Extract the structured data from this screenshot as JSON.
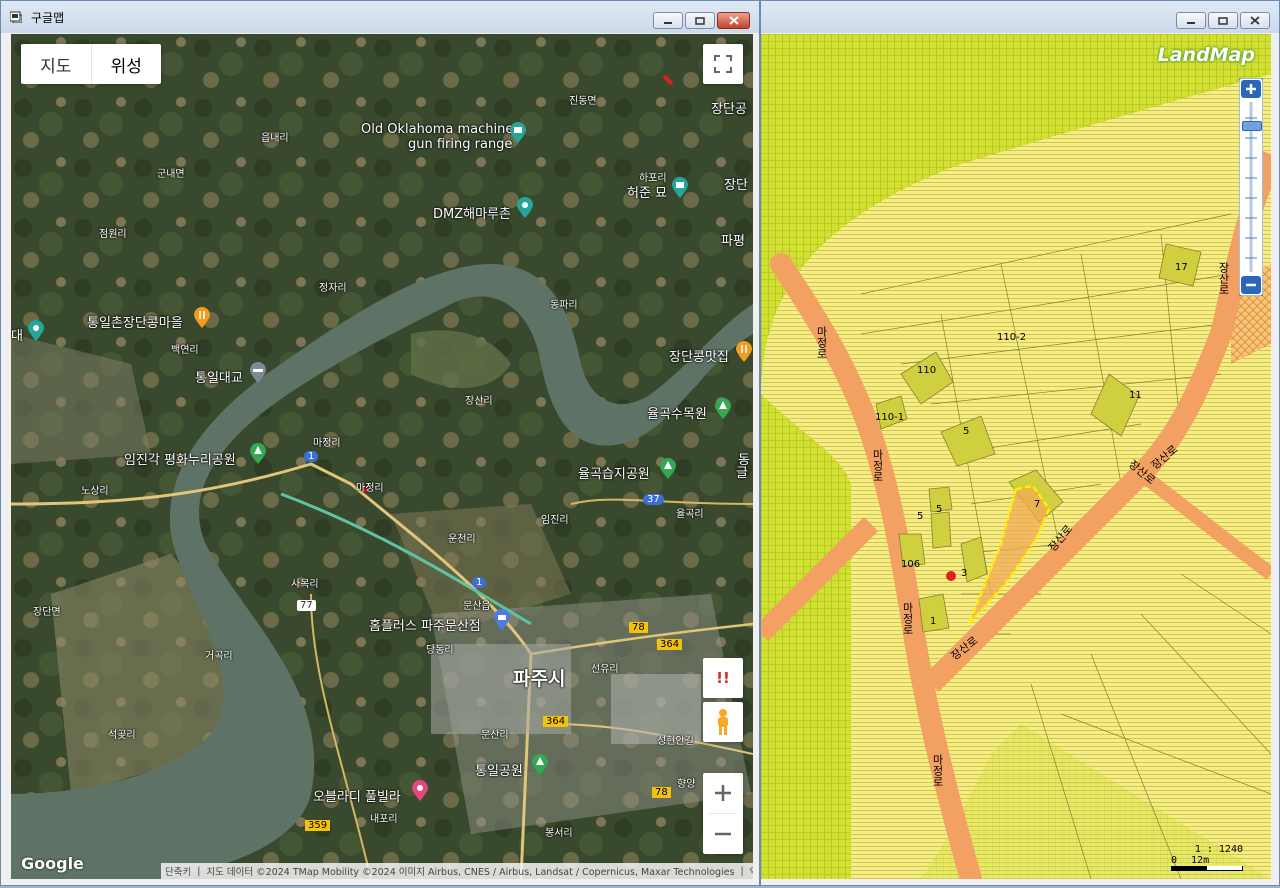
{
  "left_window": {
    "title": "구글맵",
    "map_type": {
      "map": "지도",
      "satellite": "위성"
    },
    "place_labels": [
      "진동면",
      "장단공",
      "Old Oklahoma machine",
      "gun firing range",
      "읍내리",
      "하포리",
      "허준 묘",
      "장단",
      "군내면",
      "DMZ해마루촌",
      "파평",
      "점원리",
      "정자리",
      "동파리",
      "대",
      "통일촌장단콩마을",
      "백연리",
      "장단콩맛집",
      "통일대교",
      "장산리",
      "율곡수목원",
      "마정리",
      "임진각 평화누리공원",
      "동",
      "율곡습지공원",
      "글",
      "노상리",
      "마정리",
      "임진리",
      "율곡리",
      "운천리",
      "사목리",
      "장단면",
      "문산읍",
      "홈플러스 파주문산점",
      "당동리",
      "파주시",
      "거곡리",
      "선유리",
      "석곶리",
      "문산리",
      "성현안길",
      "통일공원",
      "향양",
      "오블라디 풀빌라",
      "내포리",
      "봉서리"
    ],
    "route_badges": [
      "1",
      "37",
      "77",
      "1",
      "78",
      "364",
      "364",
      "78",
      "359"
    ],
    "report_label": "!!",
    "google_logo": "Google",
    "attribution": [
      "단축키",
      "지도 데이터 ©2024 TMap Mobility ©2024 이미지 Airbus, CNES / Airbus, Landsat / Copernicus, Maxar Technologies",
      "약관"
    ]
  },
  "right_window": {
    "logo": "LandMap",
    "parcel_labels": [
      "17",
      "110-2",
      "110",
      "110-1",
      "11",
      "5",
      "5",
      "5",
      "7",
      "106",
      "3",
      "1"
    ],
    "road_labels": [
      "마정로",
      "마정로",
      "마정로",
      "마정로",
      "장산로",
      "장산로",
      "장산로",
      "장산로",
      "장산로"
    ],
    "scale_ratio": "1 : 1240",
    "scale_zero": "0",
    "scale_dist": "12m",
    "zoom_level": 0.88
  },
  "colors": {
    "titlebar": "#cdd9ea",
    "close": "#c3432b",
    "road": "#f3a063",
    "zone_green": "#d2e032",
    "zone_yellow": "#f4ec7a",
    "parcel": "#cfcf3f",
    "river": "#5e7366"
  },
  "icons": [
    "fullscreen-icon",
    "pegman-icon",
    "zoom-in-icon",
    "zoom-out-icon",
    "camera-icon",
    "restaurant-icon",
    "bridge-icon",
    "park-icon",
    "shopping-icon",
    "attraction-icon",
    "pin-icon"
  ]
}
